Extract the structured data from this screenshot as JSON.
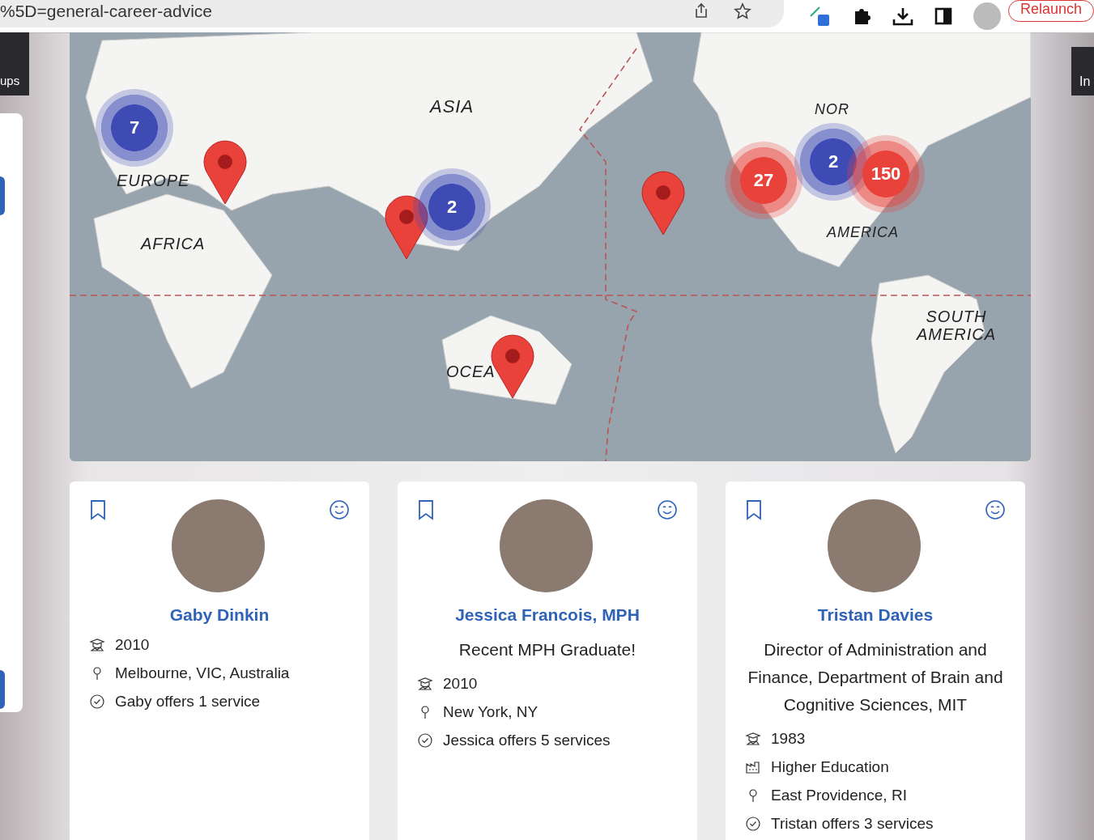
{
  "browser": {
    "url": "%5D=general-career-advice",
    "relaunch": "Relaunch"
  },
  "left_tab": {
    "label": "ups"
  },
  "right_tab": {
    "label": "In"
  },
  "map": {
    "labels": [
      {
        "text": "ASIA"
      },
      {
        "text": "EUROPE"
      },
      {
        "text": "AFRICA"
      },
      {
        "text": "OCEA"
      },
      {
        "text": "NOR"
      },
      {
        "text": "AMERICA"
      },
      {
        "text": "SOUTH AMERICA"
      }
    ],
    "clusters": [
      {
        "count": "7",
        "color": "#3f4bb5"
      },
      {
        "count": "2",
        "color": "#3f4bb5"
      },
      {
        "count": "27",
        "color": "#e8423b"
      },
      {
        "count": "2",
        "color": "#3f4bb5"
      },
      {
        "count": "150",
        "color": "#e8423b"
      }
    ]
  },
  "mentors": [
    {
      "name": "Gaby Dinkin",
      "details": [
        {
          "kind": "graduation",
          "text": "2010"
        },
        {
          "kind": "location",
          "text": "Melbourne, VIC, Australia"
        },
        {
          "kind": "services",
          "text": "Gaby offers 1 service"
        }
      ]
    },
    {
      "name": "Jessica Francois, MPH",
      "headline": "Recent MPH Graduate!",
      "details": [
        {
          "kind": "graduation",
          "text": "2010"
        },
        {
          "kind": "location",
          "text": "New York, NY"
        },
        {
          "kind": "services",
          "text": "Jessica offers 5 services"
        }
      ]
    },
    {
      "name": "Tristan Davies",
      "headline": "Director of Administration and Finance, Department of Brain and Cognitive Sciences, MIT",
      "details": [
        {
          "kind": "graduation",
          "text": "1983"
        },
        {
          "kind": "industry",
          "text": "Higher Education"
        },
        {
          "kind": "location",
          "text": "East Providence, RI"
        },
        {
          "kind": "services",
          "text": "Tristan offers 3 services"
        }
      ]
    }
  ]
}
